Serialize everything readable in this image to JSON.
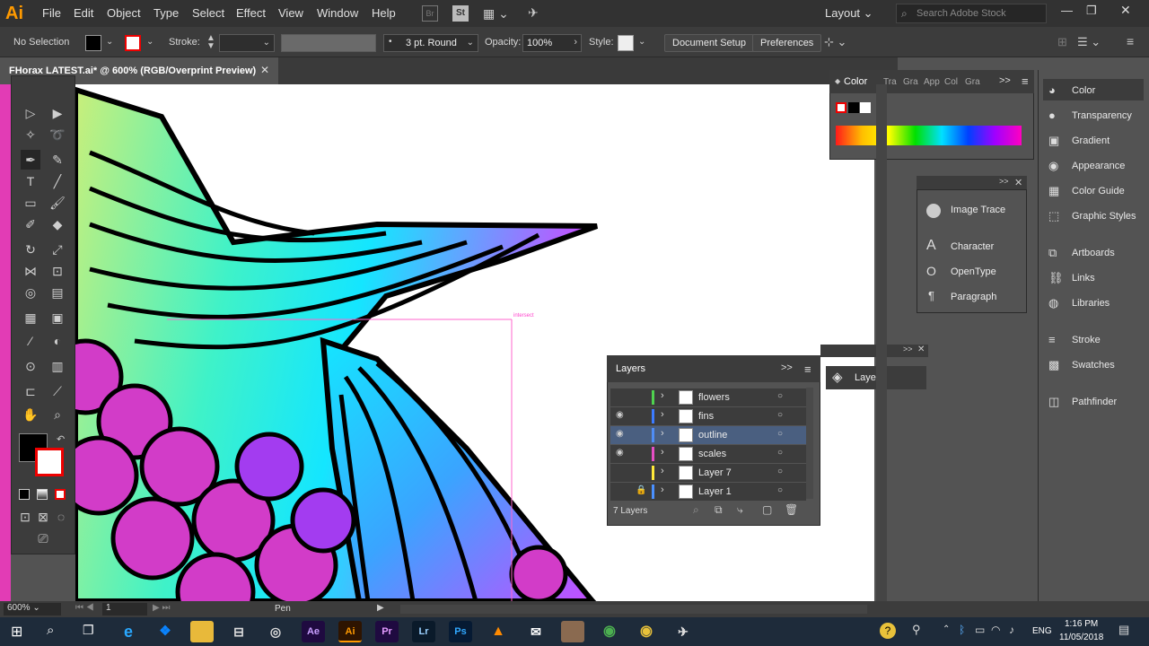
{
  "app": {
    "logo": "Ai"
  },
  "menu": [
    "File",
    "Edit",
    "Object",
    "Type",
    "Select",
    "Effect",
    "View",
    "Window",
    "Help"
  ],
  "menubar_right": {
    "workspace": "Layout",
    "search_placeholder": "Search Adobe Stock"
  },
  "control": {
    "selection": "No Selection",
    "stroke_label": "Stroke:",
    "brush": "3 pt. Round",
    "opacity_label": "Opacity:",
    "opacity": "100%",
    "style_label": "Style:",
    "document_setup": "Document Setup",
    "preferences": "Preferences"
  },
  "document": {
    "tab": "FHorax LATEST.ai* @ 600% (RGB/Overprint Preview)",
    "smart_guide": "intersect"
  },
  "color_panel": {
    "title": "Color",
    "tabs": [
      "Tra",
      "Gra",
      "App",
      "Col",
      "Gra"
    ]
  },
  "trace_panel": {
    "items": [
      "Image Trace",
      "Character",
      "OpenType",
      "Paragraph"
    ]
  },
  "right_dock": {
    "items": [
      "Color",
      "Transparency",
      "Gradient",
      "Appearance",
      "Color Guide",
      "Graphic Styles",
      "Artboards",
      "Links",
      "Libraries",
      "Stroke",
      "Swatches",
      "Pathfinder"
    ]
  },
  "layers": {
    "title": "Layers",
    "count": "7 Layers",
    "rows": [
      {
        "name": "flowers",
        "color": "#4fd24f",
        "visible": false,
        "locked": false,
        "selected": false
      },
      {
        "name": "fins",
        "color": "#3c7bff",
        "visible": true,
        "locked": false,
        "selected": false
      },
      {
        "name": "outline",
        "color": "#4f8df6",
        "visible": true,
        "locked": false,
        "selected": true
      },
      {
        "name": "scales",
        "color": "#e64ec4",
        "visible": true,
        "locked": false,
        "selected": false
      },
      {
        "name": "Layer 7",
        "color": "#ffe93a",
        "visible": false,
        "locked": false,
        "selected": false
      },
      {
        "name": "Layer 1",
        "color": "#4a90ff",
        "visible": false,
        "locked": true,
        "selected": false
      }
    ]
  },
  "layers_mini": {
    "title": "Layers"
  },
  "status": {
    "zoom": "600%",
    "artboard": "1",
    "tool": "Pen"
  },
  "taskbar": {
    "time": "1:16 PM",
    "date": "11/05/2018",
    "lang": "ENG"
  }
}
